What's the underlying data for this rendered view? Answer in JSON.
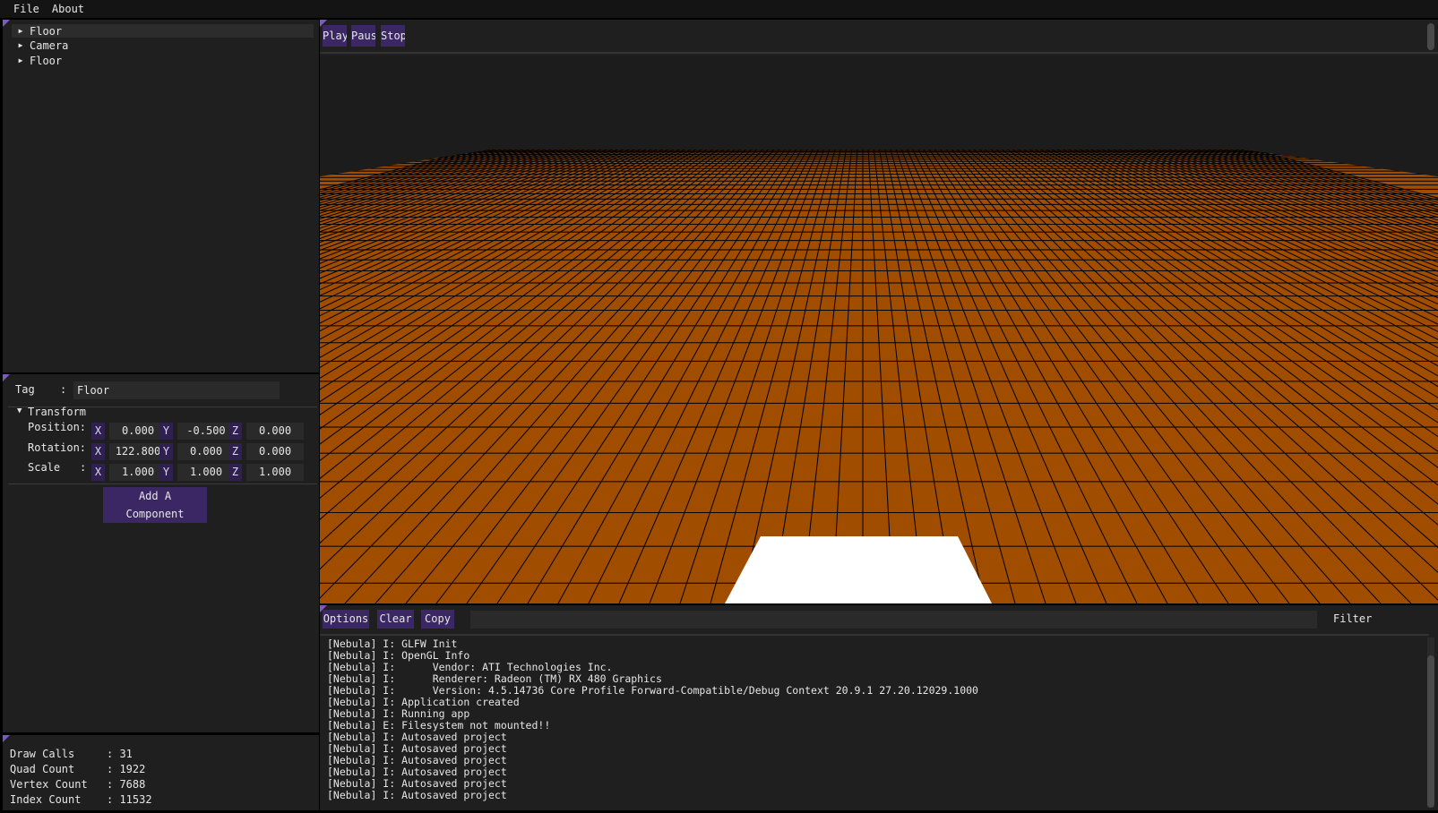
{
  "menu": {
    "file": "File",
    "about": "About"
  },
  "hierarchy": {
    "items": [
      {
        "label": "Floor",
        "selected": true
      },
      {
        "label": "Camera",
        "selected": false
      },
      {
        "label": "Floor",
        "selected": false
      }
    ]
  },
  "inspector": {
    "tag_label": "Tag",
    "tag_colon": ":",
    "tag_value": "Floor",
    "transform_header": "Transform",
    "position_label": "Position:",
    "rotation_label": "Rotation:",
    "scale_label": "Scale",
    "scale_colon": ":",
    "axes": {
      "x": "X",
      "y": "Y",
      "z": "Z"
    },
    "position": {
      "x": "0.000",
      "y": "-0.500",
      "z": "0.000"
    },
    "rotation": {
      "x": "122.800",
      "y": "0.000",
      "z": "0.000"
    },
    "scale": {
      "x": "1.000",
      "y": "1.000",
      "z": "1.000"
    },
    "add_component": "Add A Component"
  },
  "stats": {
    "rows": [
      {
        "name": "Draw Calls",
        "value": ": 31"
      },
      {
        "name": "Quad Count",
        "value": ": 1922"
      },
      {
        "name": "Vertex Count",
        "value": ": 7688"
      },
      {
        "name": "Index Count",
        "value": ": 11532"
      }
    ]
  },
  "viewport": {
    "play": "Play",
    "pause": "Pause",
    "stop": "Stop",
    "colors": {
      "floor": "#a04d00",
      "grid": "#000000",
      "quad": "#ffffff",
      "background": "#1c1c1c"
    }
  },
  "console": {
    "options": "Options",
    "clear": "Clear",
    "copy": "Copy",
    "filter_label": "Filter",
    "lines": [
      "[Nebula] I: GLFW Init",
      "[Nebula] I: OpenGL Info",
      "[Nebula] I:      Vendor: ATI Technologies Inc.",
      "[Nebula] I:      Renderer: Radeon (TM) RX 480 Graphics",
      "[Nebula] I:      Version: 4.5.14736 Core Profile Forward-Compatible/Debug Context 20.9.1 27.20.12029.1000",
      "[Nebula] I: Application created",
      "[Nebula] I: Running app",
      "[Nebula] E: Filesystem not mounted!!",
      "[Nebula] I: Autosaved project",
      "[Nebula] I: Autosaved project",
      "[Nebula] I: Autosaved project",
      "[Nebula] I: Autosaved project",
      "[Nebula] I: Autosaved project",
      "[Nebula] I: Autosaved project"
    ]
  },
  "theme": {
    "accent": "#3a2764",
    "panel": "#1f1f1f",
    "menubar": "#141414"
  }
}
